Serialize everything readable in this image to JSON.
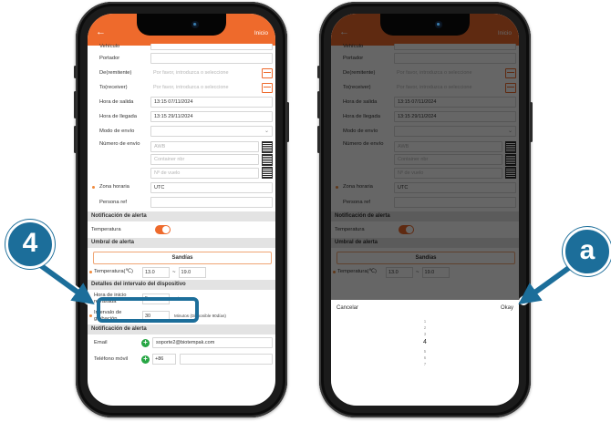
{
  "colors": {
    "accent": "#ee6a2c",
    "callout": "#1c6e9a",
    "switch_on": "#ee6a2c",
    "add_button": "#27a644"
  },
  "callouts": {
    "left": "4",
    "right": "a"
  },
  "header": {
    "back_icon": "arrow-left-icon",
    "title": "",
    "home_label": "Inicio"
  },
  "form": {
    "vehicle_label": "Vehículo",
    "carrier_label": "Portador",
    "sender_label": "De(remitente)",
    "sender_placeholder": "Por favor, introduzca o seleccione",
    "receiver_label": "To(receiver)",
    "receiver_placeholder": "Por favor, introduzca o seleccione",
    "departure_label": "Hora de salida",
    "departure_value": "13:15 07/11/2024",
    "arrival_label": "Hora de llegada",
    "arrival_value": "13:15 29/11/2024",
    "shipping_mode_label": "Modo de envío",
    "shipment_number_label": "Número de envío",
    "awb_placeholder": "AWB",
    "container_placeholder": "Container nbr",
    "flight_placeholder": "Nº de vuelo",
    "timezone_label": "Zona horaria",
    "timezone_value": "UTC",
    "reference_label": "Persona ref"
  },
  "alerts": {
    "section_title": "Notificación de alerta",
    "temperature_label": "Temperatura",
    "threshold_title": "Umbral de alerta",
    "product_name": "Sandías",
    "temp_range_label": "Temperatura(℃)",
    "temp_min": "13.0",
    "temp_max": "19.0",
    "temp_separator": "~"
  },
  "interval": {
    "section_title": "Detalles del intervalo del dispositivo",
    "delay_label": "Hora de inicio retrasada",
    "delay_value": "5",
    "delay_unit": "Minutos",
    "record_label": "Intervalo de grabación",
    "record_value": "30",
    "record_unit": "Minutos (Disponible 90días)"
  },
  "notify": {
    "section_title": "Notificación de alerta",
    "email_label": "Email",
    "email_value": "soporte2@biotempak.com",
    "phone_label": "Teléfono móvil",
    "phone_code": "+86"
  },
  "picker": {
    "cancel_label": "Cancelar",
    "okay_label": "Okay",
    "above": [
      "1",
      "2",
      "3"
    ],
    "selected": "4",
    "below": [
      "5",
      "6",
      "7"
    ]
  }
}
